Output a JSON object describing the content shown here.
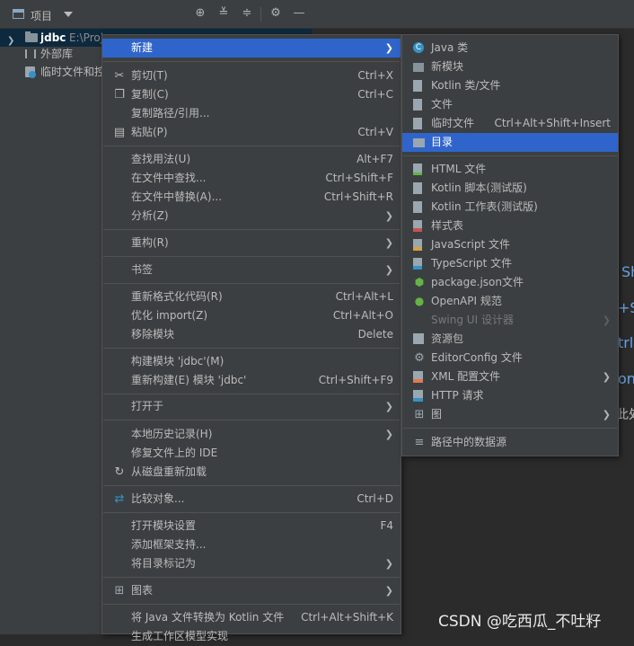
{
  "panel": {
    "title": "项目",
    "header_icons": [
      "locate-icon",
      "expand-all-icon",
      "collapse-all-icon",
      "gear-icon",
      "minimize-icon"
    ]
  },
  "tree": {
    "items": [
      {
        "label": "jdbc",
        "path": "E:\\Proje",
        "icon": "module-folder-icon"
      },
      {
        "label": "外部库",
        "icon": "library-icon"
      },
      {
        "label": "临时文件和控",
        "icon": "scratch-icon"
      }
    ]
  },
  "context_menu": {
    "items": [
      {
        "label": "新建",
        "shortcut": "",
        "submenu": true,
        "highlighted": true
      },
      {
        "label": "剪切(T)",
        "shortcut": "Ctrl+X",
        "icon": "scissors-icon"
      },
      {
        "label": "复制(C)",
        "shortcut": "Ctrl+C",
        "icon": "copy-icon"
      },
      {
        "label": "复制路径/引用...",
        "shortcut": ""
      },
      {
        "label": "粘贴(P)",
        "shortcut": "Ctrl+V",
        "icon": "paste-icon"
      },
      {
        "label": "查找用法(U)",
        "shortcut": "Alt+F7"
      },
      {
        "label": "在文件中查找...",
        "shortcut": "Ctrl+Shift+F"
      },
      {
        "label": "在文件中替换(A)...",
        "shortcut": "Ctrl+Shift+R"
      },
      {
        "label": "分析(Z)",
        "shortcut": "",
        "submenu": true
      },
      {
        "label": "重构(R)",
        "shortcut": "",
        "submenu": true
      },
      {
        "label": "书签",
        "shortcut": "",
        "submenu": true
      },
      {
        "label": "重新格式化代码(R)",
        "shortcut": "Ctrl+Alt+L"
      },
      {
        "label": "优化 import(Z)",
        "shortcut": "Ctrl+Alt+O"
      },
      {
        "label": "移除模块",
        "shortcut": "Delete"
      },
      {
        "label": "构建模块 'jdbc'(M)",
        "shortcut": ""
      },
      {
        "label": "重新构建(E) 模块 'jdbc'",
        "shortcut": "Ctrl+Shift+F9"
      },
      {
        "label": "打开于",
        "shortcut": "",
        "submenu": true
      },
      {
        "label": "本地历史记录(H)",
        "shortcut": "",
        "submenu": true
      },
      {
        "label": "修复文件上的 IDE",
        "shortcut": ""
      },
      {
        "label": "从磁盘重新加载",
        "shortcut": "",
        "icon": "reload-icon"
      },
      {
        "label": "比较对象...",
        "shortcut": "Ctrl+D",
        "icon": "compare-icon"
      },
      {
        "label": "打开模块设置",
        "shortcut": "F4"
      },
      {
        "label": "添加框架支持...",
        "shortcut": ""
      },
      {
        "label": "将目录标记为",
        "shortcut": "",
        "submenu": true
      },
      {
        "label": "图表",
        "shortcut": "",
        "submenu": true,
        "icon": "diagram-icon"
      },
      {
        "label": "将 Java 文件转换为 Kotlin 文件",
        "shortcut": "Ctrl+Alt+Shift+K"
      },
      {
        "label": "生成工作区模型实现",
        "shortcut": ""
      }
    ]
  },
  "submenu_new": {
    "items": [
      {
        "label": "Java 类",
        "shortcut": "",
        "icon": "java-class-icon"
      },
      {
        "label": "新模块",
        "shortcut": "",
        "icon": "module-icon"
      },
      {
        "label": "Kotlin 类/文件",
        "shortcut": "",
        "icon": "kotlin-file-icon"
      },
      {
        "label": "文件",
        "shortcut": "",
        "icon": "file-icon"
      },
      {
        "label": "临时文件",
        "shortcut": "Ctrl+Alt+Shift+Insert",
        "icon": "scratch-file-icon"
      },
      {
        "label": "目录",
        "shortcut": "",
        "icon": "folder-icon",
        "highlighted": true
      },
      {
        "label": "HTML 文件",
        "shortcut": "",
        "icon": "html-icon"
      },
      {
        "label": "Kotlin 脚本(测试版)",
        "shortcut": "",
        "icon": "kotlin-script-icon"
      },
      {
        "label": "Kotlin 工作表(测试版)",
        "shortcut": "",
        "icon": "kotlin-worksheet-icon"
      },
      {
        "label": "样式表",
        "shortcut": "",
        "icon": "css-icon"
      },
      {
        "label": "JavaScript 文件",
        "shortcut": "",
        "icon": "javascript-icon"
      },
      {
        "label": "TypeScript 文件",
        "shortcut": "",
        "icon": "typescript-icon"
      },
      {
        "label": "package.json文件",
        "shortcut": "",
        "icon": "nodejs-icon"
      },
      {
        "label": "OpenAPI 规范",
        "shortcut": "",
        "icon": "openapi-icon"
      },
      {
        "label": "Swing UI 设计器",
        "shortcut": "",
        "submenu": true,
        "disabled": true
      },
      {
        "label": "资源包",
        "shortcut": "",
        "icon": "resource-bundle-icon"
      },
      {
        "label": "EditorConfig 文件",
        "shortcut": "",
        "icon": "editorconfig-gear-icon"
      },
      {
        "label": "XML 配置文件",
        "shortcut": "",
        "submenu": true,
        "icon": "xml-icon"
      },
      {
        "label": "HTTP 请求",
        "shortcut": "",
        "icon": "http-request-icon"
      },
      {
        "label": "图",
        "shortcut": "",
        "submenu": true,
        "icon": "diagram-icon"
      },
      {
        "label": "路径中的数据源",
        "shortcut": "",
        "icon": "datasource-icon"
      }
    ]
  },
  "editor_fragments": [
    "Sh",
    "+S",
    "trl+",
    "on",
    "此处"
  ],
  "watermark": "CSDN @吃西瓜_不吐籽",
  "colors": {
    "menu_bg": "#3c3f41",
    "highlight": "#2f65ca",
    "editor_bg": "#2b2b2b",
    "selection": "#0d293e"
  }
}
